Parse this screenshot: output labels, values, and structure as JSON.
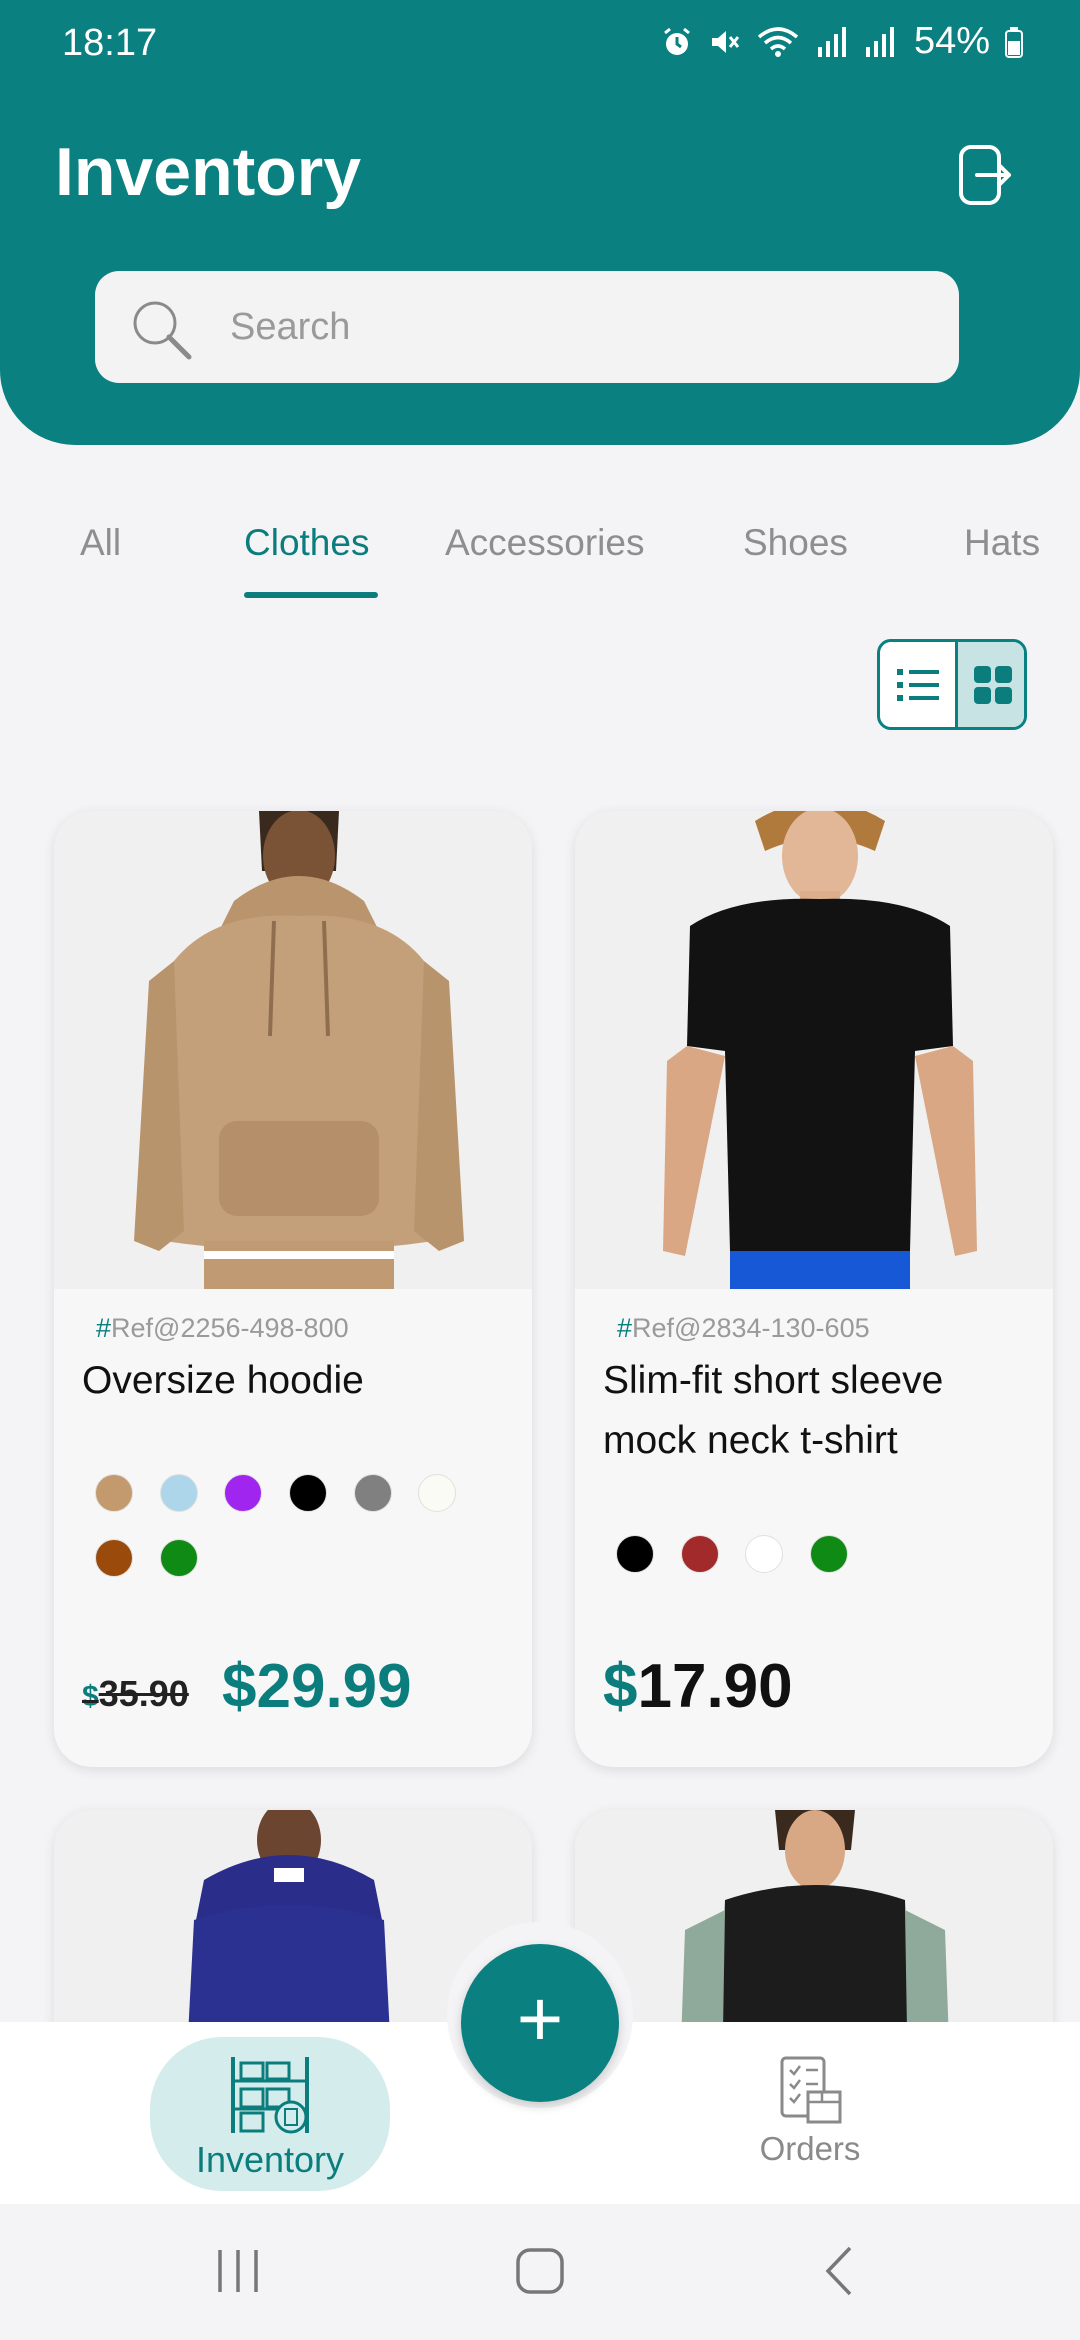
{
  "status_bar": {
    "time": "18:17",
    "battery": "54%"
  },
  "header": {
    "title": "Inventory"
  },
  "search": {
    "placeholder": "Search"
  },
  "tabs": [
    {
      "label": "All"
    },
    {
      "label": "Clothes",
      "active": true
    },
    {
      "label": "Accessories"
    },
    {
      "label": "Shoes"
    },
    {
      "label": "Hats"
    }
  ],
  "view_toggle": {
    "selected": "grid"
  },
  "products": [
    {
      "ref_hash": "#",
      "ref": "Ref@2256-498-800",
      "name": "Oversize hoodie",
      "colors": [
        "#c29a6e",
        "#aed6ea",
        "#a026ef",
        "#000000",
        "#808080",
        "#fbfbf5",
        "#9a4b0c",
        "#0f8a14"
      ],
      "currency": "$",
      "old_price": "35.90",
      "price": "$29.99"
    },
    {
      "ref_hash": "#",
      "ref": "Ref@2834-130-605",
      "name": "Slim-fit short sleeve mock neck t-shirt",
      "colors": [
        "#000000",
        "#a32a2a",
        "#ffffff",
        "#0f8a14"
      ],
      "currency": "$",
      "price": "17.90"
    }
  ],
  "bottom_nav": {
    "inventory_label": "Inventory",
    "orders_label": "Orders",
    "add_label": "+"
  },
  "colors": {
    "accent": "#0b8080",
    "accent_light": "#d4ecec",
    "background": "#f4f4f6"
  }
}
